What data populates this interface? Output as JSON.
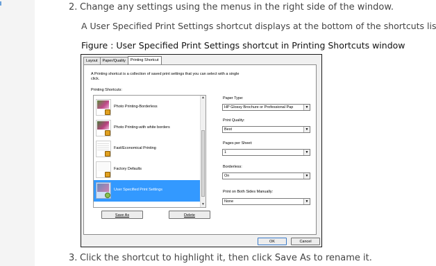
{
  "steps": {
    "step2_number": "2.",
    "step2_text": "Change any settings using the menus in the right side of the window.",
    "step2_result": "A User Specified Print Settings shortcut displays at the bottom of the shortcuts list.",
    "figure_caption": "Figure : User Specified Print Settings shortcut in Printing Shortcuts window",
    "step3_number": "3.",
    "step3_text": "Click the shortcut to highlight it, then click Save As to rename it."
  },
  "dialog": {
    "tabs": [
      {
        "label": "Layout"
      },
      {
        "label": "Paper/Quality"
      },
      {
        "label": "Printing Shortcut"
      }
    ],
    "intro": "A Printing shortcut is a collection of saved print settings that you can select with a single click.",
    "shortcuts_label": "Printing Shortcuts:",
    "shortcuts": [
      {
        "label": "Photo Printing-Borderless",
        "icon": "photo-icon",
        "selected": false
      },
      {
        "label": "Photo Printing-with white borders",
        "icon": "photo-icon",
        "selected": false
      },
      {
        "label": "Fast/Economical Printing",
        "icon": "document-icon",
        "selected": false
      },
      {
        "label": "Factory Defaults",
        "icon": "document-icon",
        "selected": false
      },
      {
        "label": "User Specified Print Settings",
        "icon": "settings-icon",
        "selected": true
      }
    ],
    "save_as_label": "Save As",
    "delete_label": "Delete",
    "paper_type_label": "Paper Type:",
    "paper_type_value": "HP Glossy Brochure or Professional Pap",
    "print_quality_label": "Print Quality:",
    "print_quality_value": "Best",
    "pages_per_sheet_label": "Pages per Sheet:",
    "pages_per_sheet_value": "1",
    "borderless_label": "Borderless:",
    "borderless_value": "On",
    "print_both_sides_label": "Print on Both Sides Manually:",
    "print_both_sides_value": "None",
    "ok_label": "OK",
    "cancel_label": "Cancel"
  },
  "colors": {
    "selection": "#3399ff",
    "lock": "#e0a020"
  }
}
